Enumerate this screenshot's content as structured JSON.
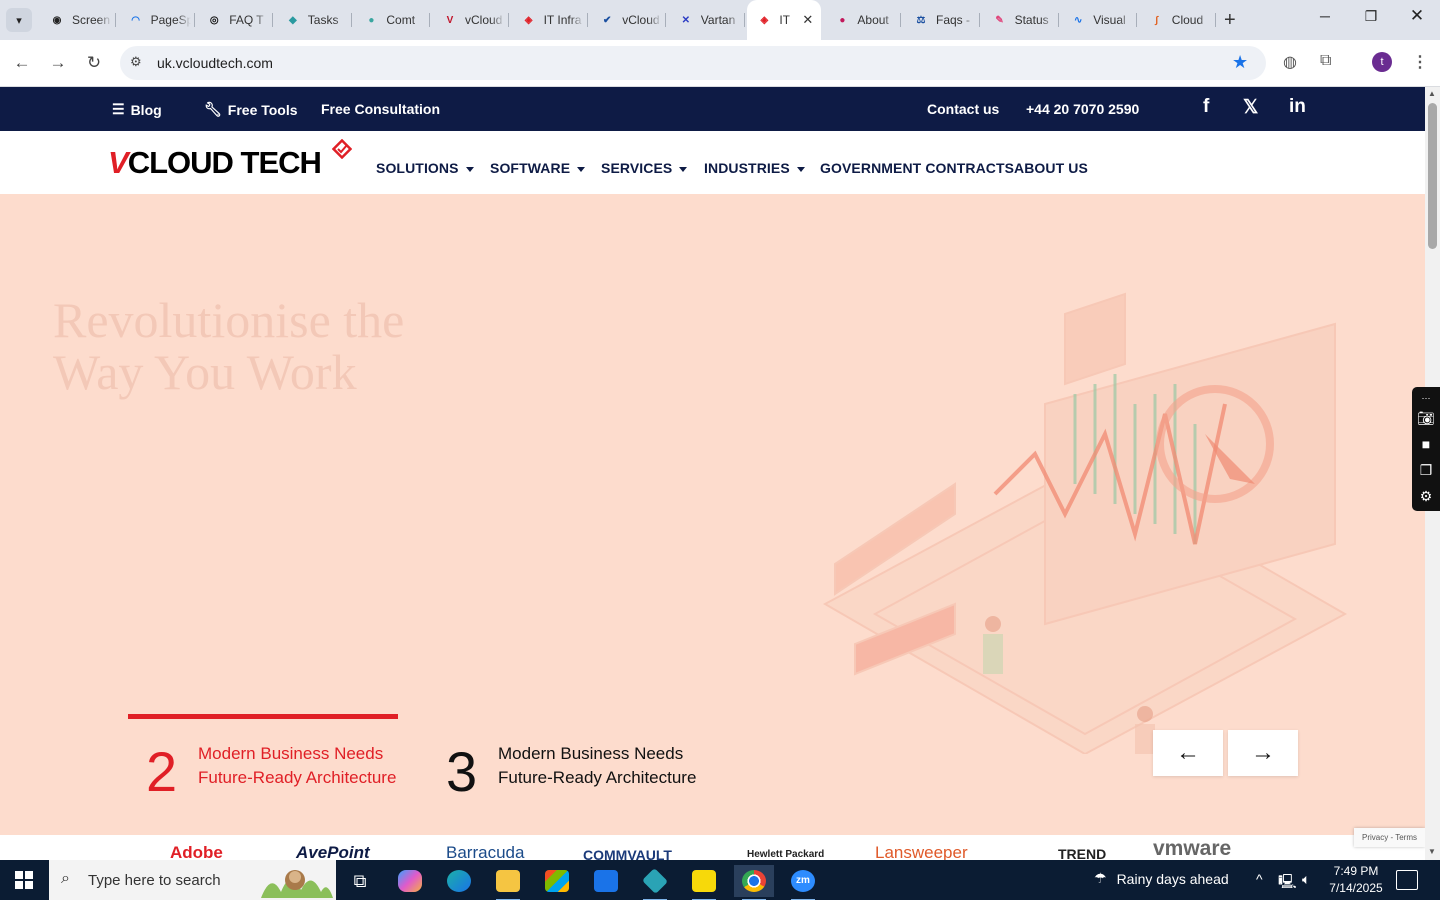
{
  "browser": {
    "tabs": [
      {
        "title": "Screen",
        "fav_color": "#222222",
        "fav_glyph": "◉"
      },
      {
        "title": "PageSpeed",
        "fav_color": "#1a73e8",
        "fav_glyph": "◠"
      },
      {
        "title": "FAQ T",
        "fav_color": "#111111",
        "fav_glyph": "◎"
      },
      {
        "title": "Tasks",
        "fav_color": "#2a9aa0",
        "fav_glyph": "◆"
      },
      {
        "title": "Comt",
        "fav_color": "#3aa6a0",
        "fav_glyph": "●"
      },
      {
        "title": "vCloud",
        "fav_color": "#c0142a",
        "fav_glyph": "V"
      },
      {
        "title": "IT Infra",
        "fav_color": "#e01f26",
        "fav_glyph": "◈"
      },
      {
        "title": "vCloud",
        "fav_color": "#1a4fa0",
        "fav_glyph": "✔"
      },
      {
        "title": "Vartan",
        "fav_color": "#2b3cc4",
        "fav_glyph": "✕"
      },
      {
        "title": "IT",
        "fav_color": "#e01f26",
        "fav_glyph": "◈",
        "active": true
      },
      {
        "title": "About",
        "fav_color": "#c2185b",
        "fav_glyph": "●"
      },
      {
        "title": "Faqs -",
        "fav_color": "#1a4fa0",
        "fav_glyph": "⚖"
      },
      {
        "title": "Status",
        "fav_color": "#e0457b",
        "fav_glyph": "✎"
      },
      {
        "title": "Visual",
        "fav_color": "#1a73e8",
        "fav_glyph": "∿"
      },
      {
        "title": "Cloud",
        "fav_color": "#e06020",
        "fav_glyph": "∫"
      }
    ],
    "url": "uk.vcloudtech.com",
    "profile_initial": "t"
  },
  "site": {
    "topbar": {
      "blog": "Blog",
      "free_tools": "Free Tools",
      "free_consultation": "Free Consultation",
      "contact": "Contact us",
      "phone": "+44 20 7070 2590",
      "social": [
        "f",
        "𝕏",
        "in"
      ]
    },
    "logo": {
      "v": "V",
      "rest": "CLOUD TECH"
    },
    "menu": [
      {
        "label": "SOLUTIONS",
        "dropdown": true
      },
      {
        "label": "SOFTWARE",
        "dropdown": true
      },
      {
        "label": "SERVICES",
        "dropdown": true
      },
      {
        "label": "INDUSTRIES",
        "dropdown": true
      },
      {
        "label": "GOVERNMENT CONTRACTS",
        "dropdown": false
      },
      {
        "label": "ABOUT US",
        "dropdown": false
      }
    ],
    "hero": {
      "title": "Revolutionise the Way You Work",
      "slides": [
        {
          "number": "2",
          "text": "Modern Business Needs Future-Ready Architecture",
          "active": true
        },
        {
          "number": "3",
          "text": "Modern Business Needs Future-Ready Architecture",
          "active": false
        }
      ],
      "prev_label": "←",
      "next_label": "→"
    },
    "partners": [
      "Adobe",
      "AvePoint",
      "Barracuda",
      "COMMVAULT",
      "Hewlett Packard",
      "Lansweeper",
      "TREND",
      "vmware"
    ],
    "recaptcha": "Privacy - Terms",
    "colors": {
      "accent": "#e01f26",
      "navy": "#0e1b45",
      "hero_bg": "#fddccd"
    }
  },
  "taskbar": {
    "search_placeholder": "Type here to search",
    "weather": "Rainy days ahead",
    "time": "7:49 PM",
    "date": "7/14/2025"
  }
}
